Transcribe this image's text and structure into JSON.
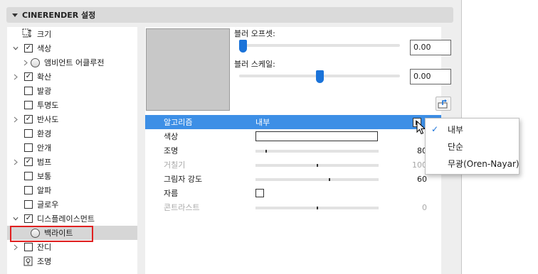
{
  "header": {
    "title": "CINERENDER 설정"
  },
  "tree": {
    "items": [
      {
        "label": "크기",
        "kind": "size"
      },
      {
        "label": "색상",
        "kind": "check",
        "checked": true,
        "expanded": true
      },
      {
        "label": "앰비언트 어클루전",
        "kind": "radio",
        "collapsed": true
      },
      {
        "label": "확산",
        "kind": "check",
        "checked": true,
        "collapsed": true
      },
      {
        "label": "발광",
        "kind": "check",
        "checked": false
      },
      {
        "label": "투명도",
        "kind": "check",
        "checked": false
      },
      {
        "label": "반사도",
        "kind": "check",
        "checked": true,
        "collapsed": true
      },
      {
        "label": "환경",
        "kind": "check",
        "checked": false
      },
      {
        "label": "안개",
        "kind": "check",
        "checked": false
      },
      {
        "label": "범프",
        "kind": "check",
        "checked": true,
        "collapsed": true
      },
      {
        "label": "보통",
        "kind": "check",
        "checked": false
      },
      {
        "label": "알파",
        "kind": "check",
        "checked": false
      },
      {
        "label": "글로우",
        "kind": "check",
        "checked": false
      },
      {
        "label": "디스플레이스먼트",
        "kind": "check",
        "checked": true,
        "expanded": true
      },
      {
        "label": "백라이트",
        "kind": "radio",
        "selected": true
      },
      {
        "label": "잔디",
        "kind": "check",
        "checked": false,
        "collapsed": true
      },
      {
        "label": "조명",
        "kind": "light"
      }
    ]
  },
  "blur_offset": {
    "label": "블러 오프셋:",
    "value": "0.00",
    "level": 0.0
  },
  "blur_scale": {
    "label": "블러 스케일:",
    "value": "0.00",
    "level": 0.5
  },
  "table": {
    "rows": [
      {
        "label": "알고리즘",
        "value": "내부",
        "kind": "dropdown",
        "selected": true
      },
      {
        "label": "색상",
        "value": "",
        "kind": "color"
      },
      {
        "label": "조명",
        "value": "80",
        "kind": "slider",
        "level": 0.08
      },
      {
        "label": "거칠기",
        "value": "100",
        "kind": "slider",
        "level": 0.5,
        "disabled": true
      },
      {
        "label": "그림자 강도",
        "value": "60",
        "kind": "slider",
        "level": 0.6
      },
      {
        "label": "자름",
        "value": "",
        "kind": "checkbox"
      },
      {
        "label": "콘트라스트",
        "value": "0",
        "kind": "slider",
        "level": 0.5,
        "disabled": true
      }
    ]
  },
  "menu": {
    "options": [
      {
        "label": "내부",
        "checked": true
      },
      {
        "label": "단순",
        "checked": false
      },
      {
        "label": "무광(Oren-Nayar)",
        "checked": false
      }
    ]
  },
  "colors": {
    "accent": "#3d8fe6",
    "slider_thumb": "#1a73d9",
    "highlight": "#e02020"
  }
}
